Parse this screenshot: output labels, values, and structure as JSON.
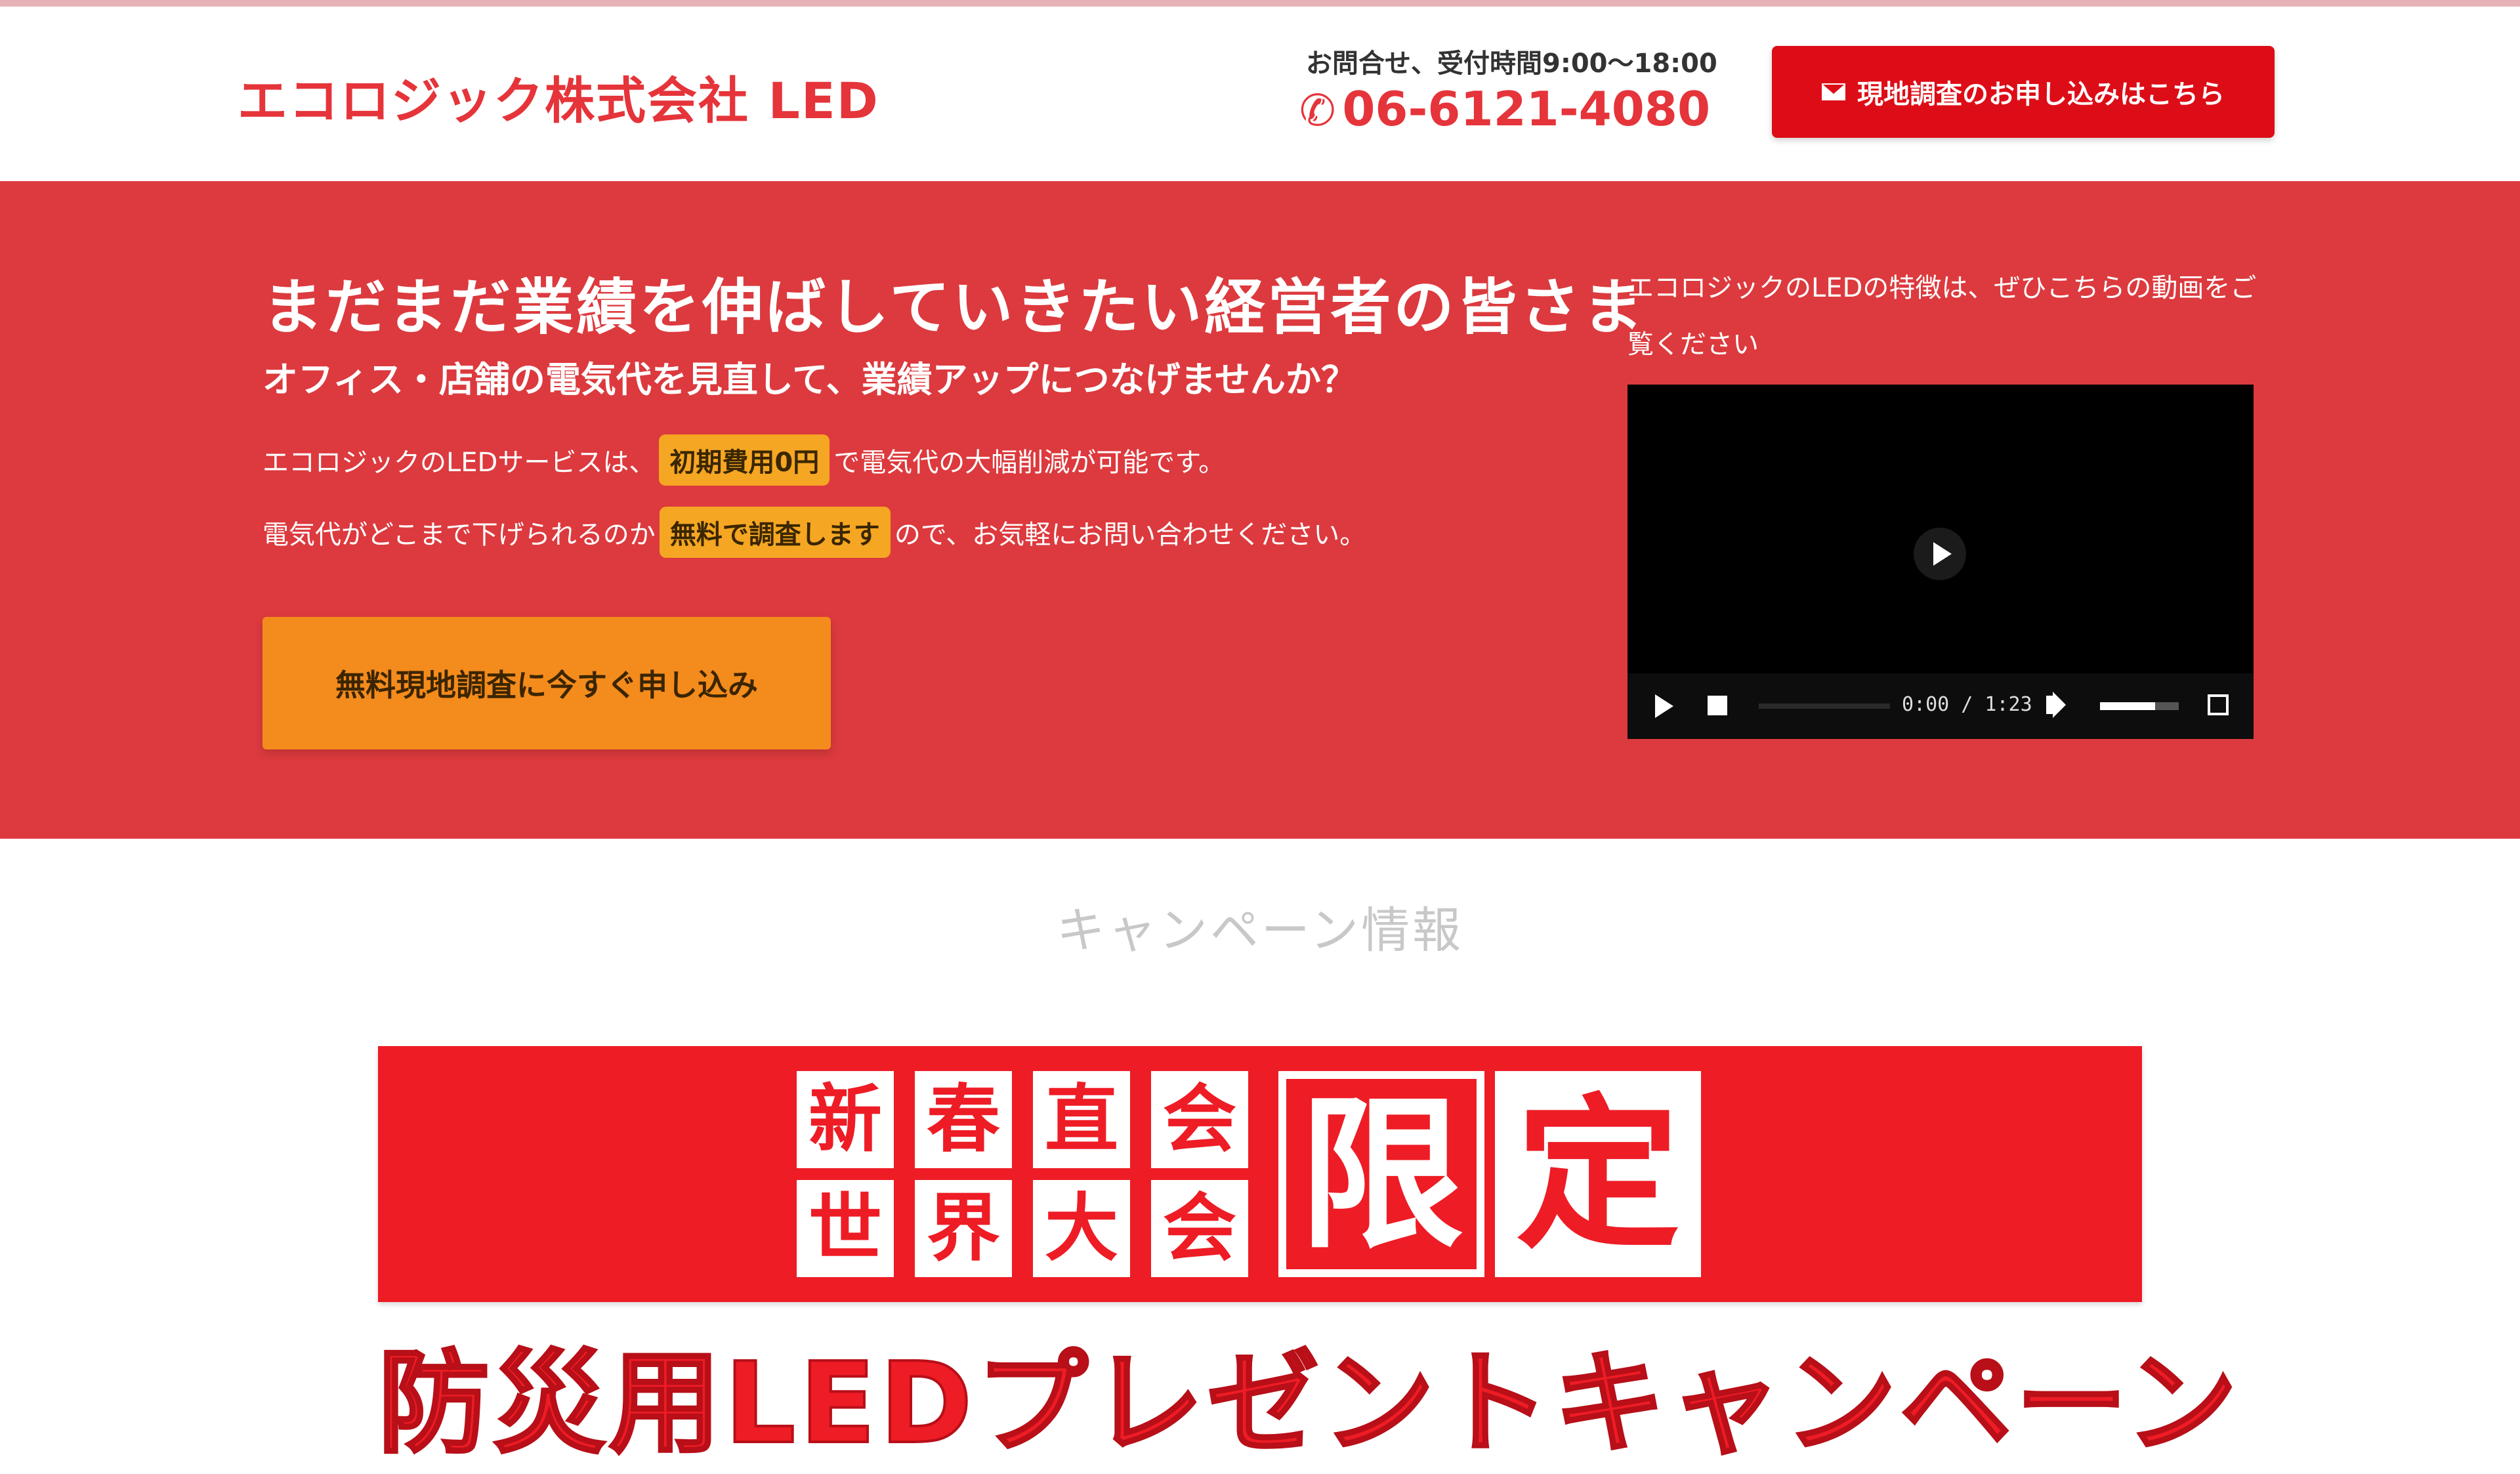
{
  "header": {
    "logo": "エコロジック株式会社 LED",
    "hours": "お問合せ、受付時間9:00～18:00",
    "phone": "06-6121-4080",
    "phone_icon": "phone-icon",
    "cta_label": "現地調査のお申し込みはこちら",
    "cta_icon": "mail-icon"
  },
  "hero": {
    "title": "まだまだ業績を伸ばしていきたい経営者の皆さま",
    "subtitle": "オフィス・店舗の電気代を見直して、業績アップにつなげませんか？",
    "line1_before": "エコロジックのLEDサービスは、",
    "line1_highlight": "初期費用0円",
    "line1_after": "で電気代の大幅削減が可能です。",
    "line2_before": "電気代がどこまで下げられるのか",
    "line2_highlight": "無料で調査します",
    "line2_after": "ので、お気軽にお問い合わせください。",
    "cta_label": "無料現地調査に今すぐ申し込み"
  },
  "video": {
    "caption": "エコロジックのLEDの特徴は、ぜひこちらの動画をご覧ください",
    "time": "0:00 / 1:23",
    "volume_level": 0.7,
    "icons": [
      "play-icon",
      "stop-icon",
      "volume-icon",
      "fullscreen-icon"
    ]
  },
  "campaign": {
    "section_title": "キャンペーン情報",
    "kanji": [
      "新",
      "春",
      "直",
      "会",
      "世",
      "界",
      "大",
      "会"
    ],
    "big_kanji": [
      "限",
      "定"
    ],
    "title": "防災用LEDプレゼントキャンペーン"
  },
  "colors": {
    "brand_red": "#dd0d17",
    "hero_red": "#dc3a3e",
    "orange": "#f48b1d",
    "highlight": "#f5a623"
  }
}
